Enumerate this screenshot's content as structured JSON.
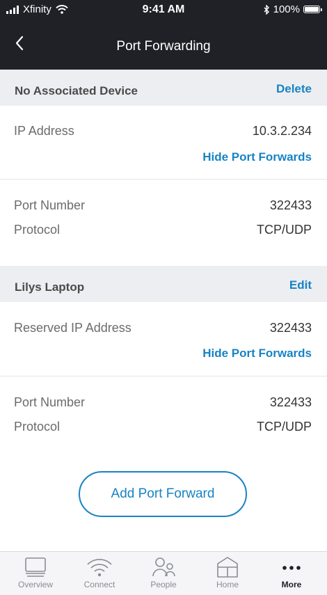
{
  "status_bar": {
    "carrier": "Xfinity",
    "time": "9:41 AM",
    "battery": "100%"
  },
  "nav": {
    "title": "Port Forwarding"
  },
  "devices": [
    {
      "name": "No Associated Device",
      "action": "Delete",
      "ip_label": "IP Address",
      "ip_value": "10.3.2.234",
      "toggle_label": "Hide Port Forwards",
      "port_label": "Port Number",
      "port_value": "322433",
      "protocol_label": "Protocol",
      "protocol_value": "TCP/UDP"
    },
    {
      "name": "Lilys Laptop",
      "action": "Edit",
      "ip_label": "Reserved IP Address",
      "ip_value": "322433",
      "toggle_label": "Hide Port Forwards",
      "port_label": "Port Number",
      "port_value": "322433",
      "protocol_label": "Protocol",
      "protocol_value": "TCP/UDP"
    }
  ],
  "add_button": "Add Port Forward",
  "tabs": [
    {
      "label": "Overview",
      "icon": "monitor-icon"
    },
    {
      "label": "Connect",
      "icon": "wifi-icon"
    },
    {
      "label": "People",
      "icon": "people-icon"
    },
    {
      "label": "Home",
      "icon": "home-icon"
    },
    {
      "label": "More",
      "icon": "more-icon",
      "active": true
    }
  ],
  "colors": {
    "accent": "#1783c4",
    "dark": "#1f2127",
    "section_bg": "#edeef1"
  }
}
